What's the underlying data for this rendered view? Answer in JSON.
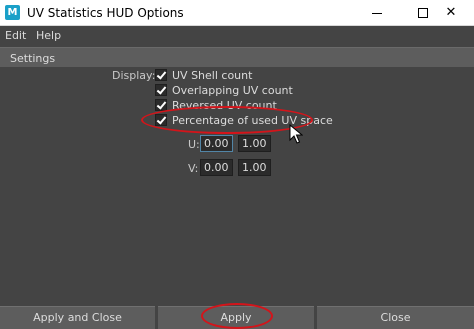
{
  "window": {
    "title": "UV Statistics HUD Options",
    "app_icon_letter": "M",
    "minimize_icon": "minimize-icon",
    "maximize_icon": "maximize-icon",
    "close_glyph": "✕"
  },
  "menu": {
    "items": [
      "Edit",
      "Help"
    ]
  },
  "settings": {
    "section_title": "Settings",
    "display_label": "Display:",
    "options": [
      {
        "label": "UV Shell count",
        "checked": true
      },
      {
        "label": "Overlapping UV count",
        "checked": true
      },
      {
        "label": "Reversed UV count",
        "checked": true
      },
      {
        "label": "Percentage of used UV space",
        "checked": true
      }
    ],
    "u": {
      "label": "U:",
      "min": "0.00",
      "max": "1.00"
    },
    "v": {
      "label": "V:",
      "min": "0.00",
      "max": "1.00"
    }
  },
  "buttons": {
    "apply_and_close": "Apply and Close",
    "apply": "Apply",
    "close": "Close"
  },
  "colors": {
    "background": "#444444",
    "section_header": "#5d5d5d",
    "annotation": "#d4141a",
    "focus": "#5285a6"
  }
}
